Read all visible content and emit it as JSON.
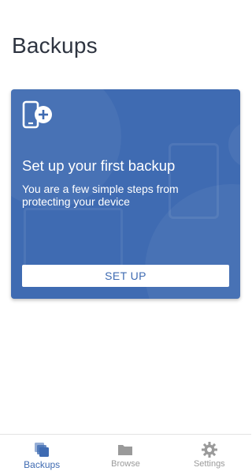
{
  "header": {
    "title": "Backups"
  },
  "card": {
    "icon": "phone-add-icon",
    "title": "Set up your first backup",
    "description": "You are a few simple steps from protecting your device",
    "button_label": "SET UP"
  },
  "bottom_nav": {
    "items": [
      {
        "label": "Backups",
        "icon": "backups-icon",
        "active": true
      },
      {
        "label": "Browse",
        "icon": "folder-icon",
        "active": false
      },
      {
        "label": "Settings",
        "icon": "gear-icon",
        "active": false
      }
    ]
  },
  "colors": {
    "accent": "#3f6bb2",
    "title_text": "#2e3440",
    "inactive": "#9a9a9a"
  }
}
